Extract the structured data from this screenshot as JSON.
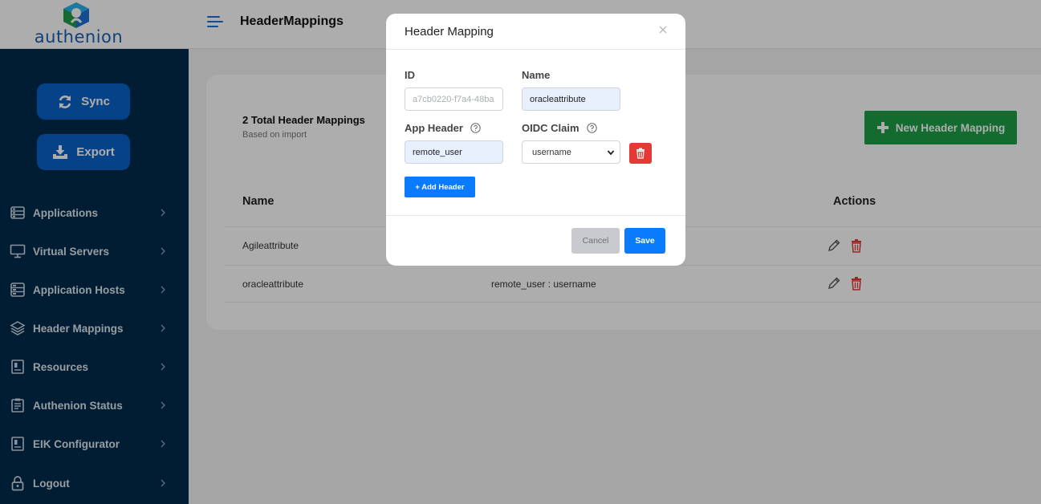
{
  "app": {
    "brand": "authenion",
    "page_title": "HeaderMappings"
  },
  "sidebar": {
    "sync_label": "Sync",
    "export_label": "Export",
    "items": [
      {
        "label": "Applications",
        "icon": "applications-icon"
      },
      {
        "label": "Virtual Servers",
        "icon": "monitor-icon"
      },
      {
        "label": "Application Hosts",
        "icon": "server-icon"
      },
      {
        "label": "Header Mappings",
        "icon": "layers-icon"
      },
      {
        "label": "Resources",
        "icon": "book-icon"
      },
      {
        "label": "Authenion Status",
        "icon": "clipboard-icon"
      },
      {
        "label": "EIK Configurator",
        "icon": "book-icon"
      },
      {
        "label": "Logout",
        "icon": "lock-icon"
      }
    ]
  },
  "main": {
    "total_title": "2 Total Header Mappings",
    "total_subtitle": "Based on import",
    "new_button": "New Header Mapping",
    "columns": {
      "name": "Name",
      "actions": "Actions"
    },
    "rows": [
      {
        "name": "Agileattribute",
        "mapping": ""
      },
      {
        "name": "oracleattribute",
        "mapping": "remote_user : username"
      }
    ]
  },
  "modal": {
    "title": "Header Mapping",
    "id_label": "ID",
    "id_value": "a7cb0220-f7a4-48ba",
    "name_label": "Name",
    "name_value": "oracleattribute",
    "app_header_label": "App Header",
    "app_header_value": "remote_user",
    "oidc_claim_label": "OIDC Claim",
    "oidc_claim_value": "username",
    "add_header_label": "+ Add Header",
    "cancel_label": "Cancel",
    "save_label": "Save"
  },
  "colors": {
    "sidebar_bg": "#002b4d",
    "primary": "#0a7aff",
    "success": "#1e9e46",
    "danger": "#e53935"
  }
}
